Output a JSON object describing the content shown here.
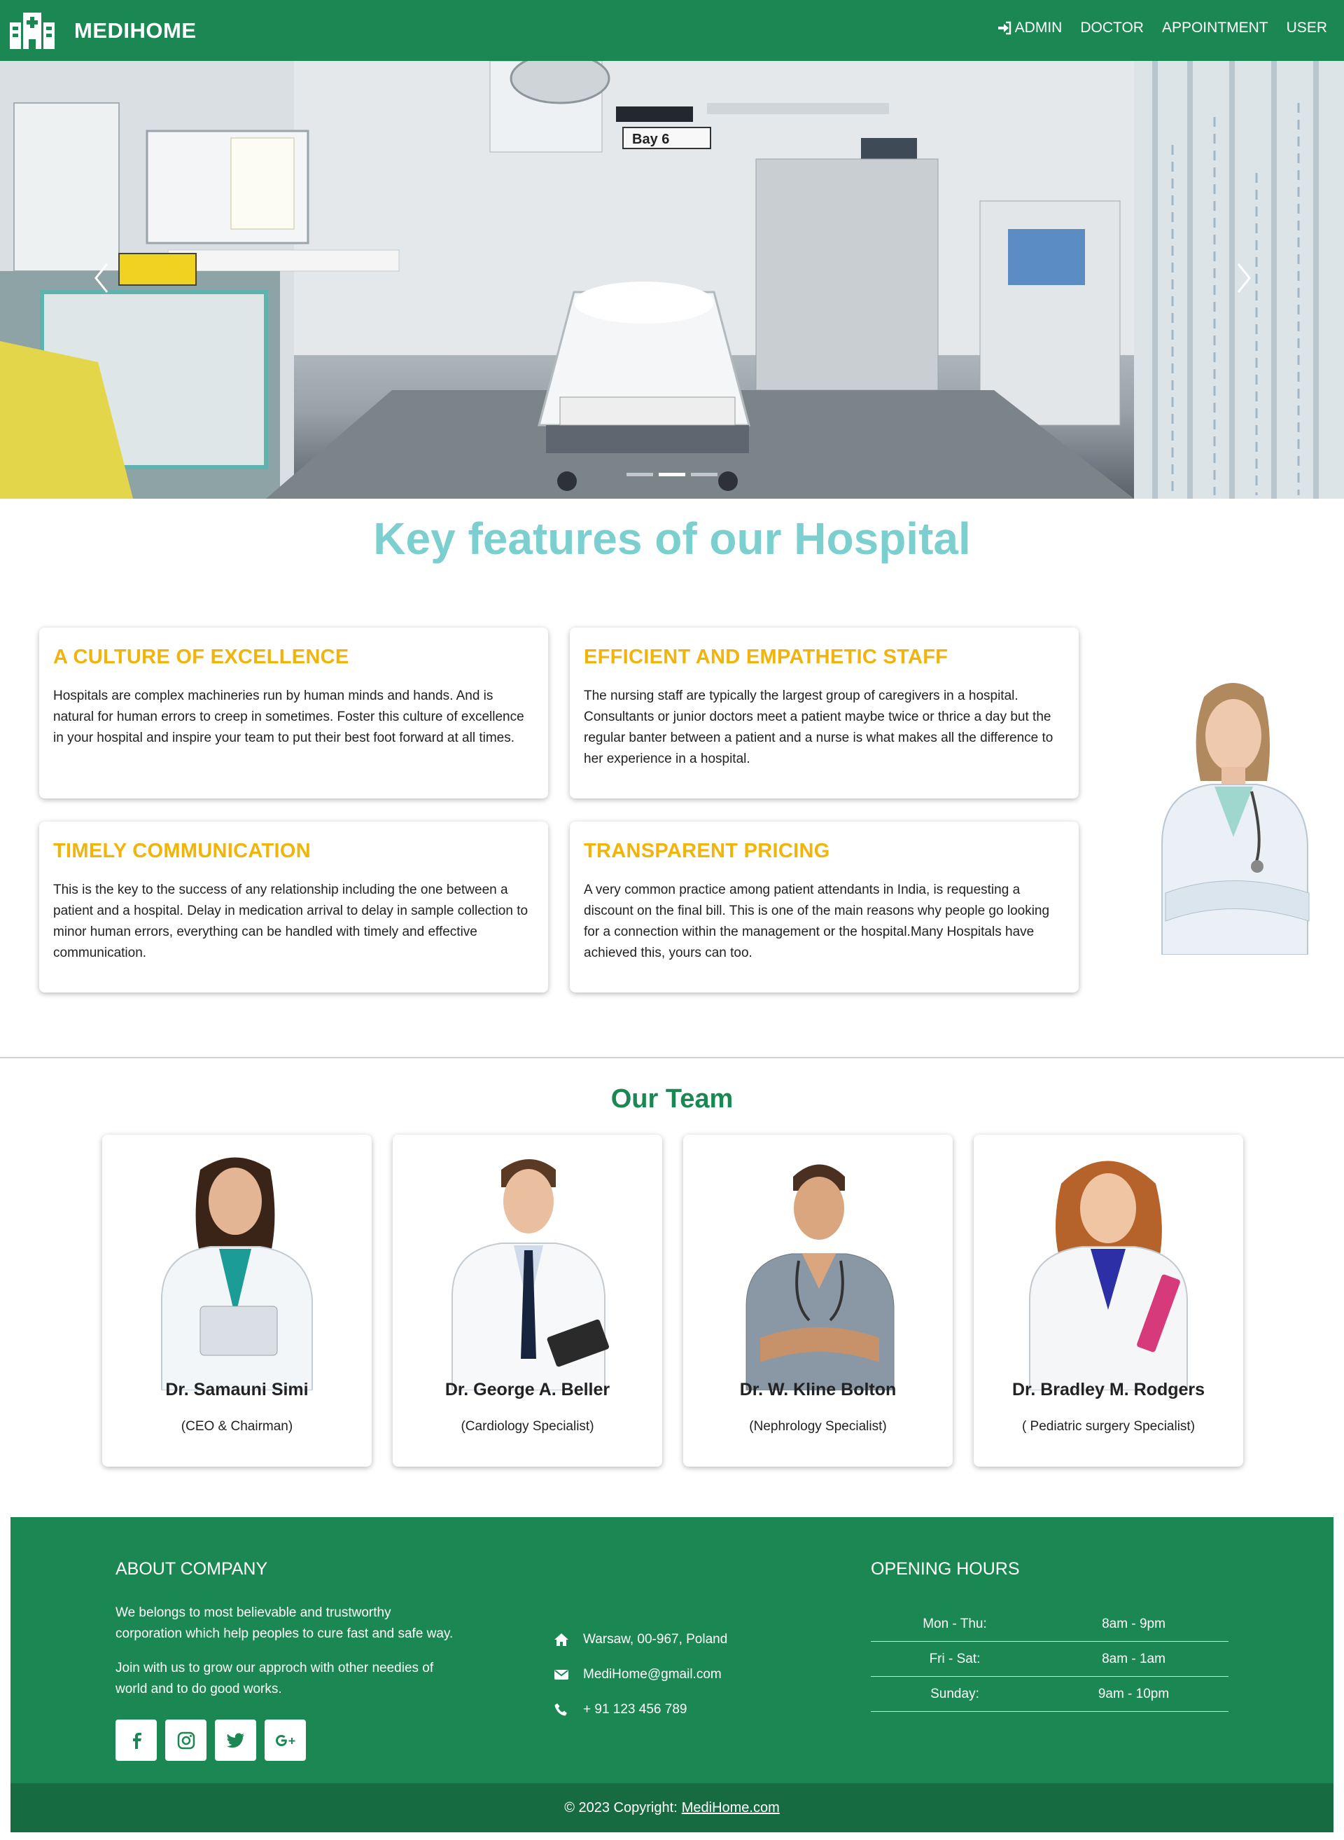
{
  "navbar": {
    "brand": "MEDIHOME",
    "links": [
      {
        "label": "ADMIN",
        "icon": "sign-in-icon"
      },
      {
        "label": "DOCTOR"
      },
      {
        "label": "APPOINTMENT"
      },
      {
        "label": "USER"
      }
    ]
  },
  "hero": {
    "bay_label": "Bay 6",
    "slide_count": 3,
    "active_slide": 2
  },
  "features": {
    "title": "Key features of our Hospital",
    "cards": [
      {
        "title": "A CULTURE OF EXCELLENCE",
        "text": "Hospitals are complex machineries run by human minds and hands. And is natural for human errors to creep in sometimes. Foster this culture of excellence in your hospital and inspire your team to put their best foot forward at all times."
      },
      {
        "title": "EFFICIENT AND EMPATHETIC STAFF",
        "text": "The nursing staff are typically the largest group of caregivers in a hospital. Consultants or junior doctors meet a patient maybe twice or thrice a day but the regular banter between a patient and a nurse is what makes all the difference to her experience in a hospital."
      },
      {
        "title": "TIMELY COMMUNICATION",
        "text": "This is the key to the success of any relationship including the one between a patient and a hospital. Delay in medication arrival to delay in sample collection to minor human errors, everything can be handled with timely and effective communication."
      },
      {
        "title": "TRANSPARENT PRICING",
        "text": "A very common practice among patient attendants in India, is requesting a discount on the final bill. This is one of the main reasons why people go looking for a connection within the management or the hospital.Many Hospitals have achieved this, yours can too."
      }
    ]
  },
  "team": {
    "title": "Our Team",
    "members": [
      {
        "name": "Dr. Samauni Simi",
        "role": "(CEO & Chairman)"
      },
      {
        "name": "Dr. George A. Beller",
        "role": "(Cardiology Specialist)"
      },
      {
        "name": "Dr. W. Kline Bolton",
        "role": "(Nephrology Specialist)"
      },
      {
        "name": "Dr. Bradley M. Rodgers",
        "role": "( Pediatric surgery Specialist)"
      }
    ]
  },
  "footer": {
    "about_heading": "ABOUT COMPANY",
    "about_line1": "We belongs to most believable and trustworthy",
    "about_line2": "corporation which help peoples to cure fast and safe way.",
    "about_line3": "Join with us to grow our approch with other needies of",
    "about_line4": "world and to do good works.",
    "social": [
      "facebook-icon",
      "instagram-icon",
      "twitter-icon",
      "google-plus-icon"
    ],
    "contact": [
      {
        "icon": "home-icon",
        "text": "Warsaw, 00-967, Poland"
      },
      {
        "icon": "mail-icon",
        "text": "MediHome@gmail.com"
      },
      {
        "icon": "phone-icon",
        "text": "+ 91 123 456 789"
      }
    ],
    "hours_heading": "OPENING HOURS",
    "hours": [
      {
        "day": "Mon - Thu:",
        "time": "8am - 9pm"
      },
      {
        "day": "Fri - Sat:",
        "time": "8am - 1am"
      },
      {
        "day": "Sunday:",
        "time": "9am - 10pm"
      }
    ],
    "copyright_prefix": "© 2023 Copyright:",
    "copyright_link": "MediHome.com"
  },
  "colors": {
    "brand_green": "#1b8752",
    "footer_dark": "#176b41",
    "feature_title": "#f1b40a",
    "heading_teal": "#7ccfcf"
  }
}
